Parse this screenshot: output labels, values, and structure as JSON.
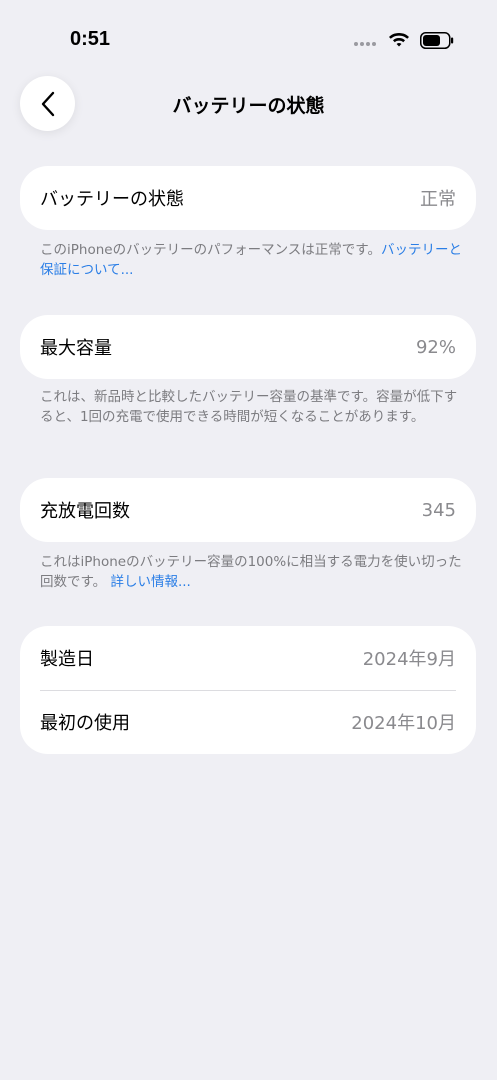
{
  "status_bar": {
    "time": "0:51"
  },
  "nav": {
    "title": "バッテリーの状態"
  },
  "sections": {
    "health": {
      "label": "バッテリーの状態",
      "value": "正常",
      "footnote": "このiPhoneのバッテリーのパフォーマンスは正常です。",
      "footnote_link": "バッテリーと保証について..."
    },
    "capacity": {
      "label": "最大容量",
      "value": "92%",
      "footnote": "これは、新品時と比較したバッテリー容量の基準です。容量が低下すると、1回の充電で使用できる時間が短くなることがあります。"
    },
    "cycles": {
      "label": "充放電回数",
      "value": "345",
      "footnote": "これはiPhoneのバッテリー容量の100%に相当する電力を使い切った回数です。",
      "footnote_link": "詳しい情報..."
    },
    "dates": {
      "manufacture_label": "製造日",
      "manufacture_value": "2024年9月",
      "first_use_label": "最初の使用",
      "first_use_value": "2024年10月"
    }
  },
  "icons": {
    "back": "chevron-left-icon",
    "wifi": "wifi-icon",
    "battery": "battery-icon",
    "signal": "signal-dots-icon"
  },
  "colors": {
    "background": "#efeff4",
    "card": "#ffffff",
    "link": "#2a7ee6",
    "secondary_text": "#8a8a8e"
  }
}
